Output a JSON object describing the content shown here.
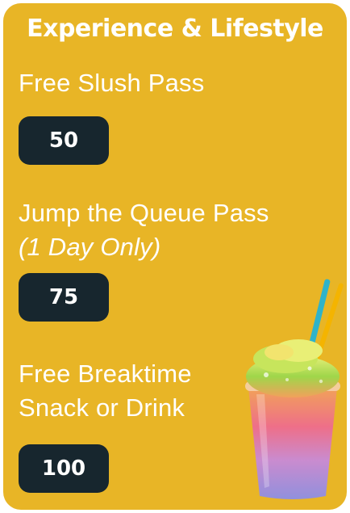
{
  "card": {
    "title": "Experience & Lifestyle",
    "background_color": "#E8B526",
    "badge_color": "#17262E"
  },
  "rewards": [
    {
      "label": "Free Slush Pass",
      "note": "",
      "points": "50"
    },
    {
      "label": "Jump the Queue Pass",
      "note": "(1 Day Only)",
      "points": "75"
    },
    {
      "label": "Free Breaktime Snack or Drink",
      "note": "",
      "points": "100"
    }
  ],
  "illustration": {
    "icon": "slush-cup-icon"
  }
}
